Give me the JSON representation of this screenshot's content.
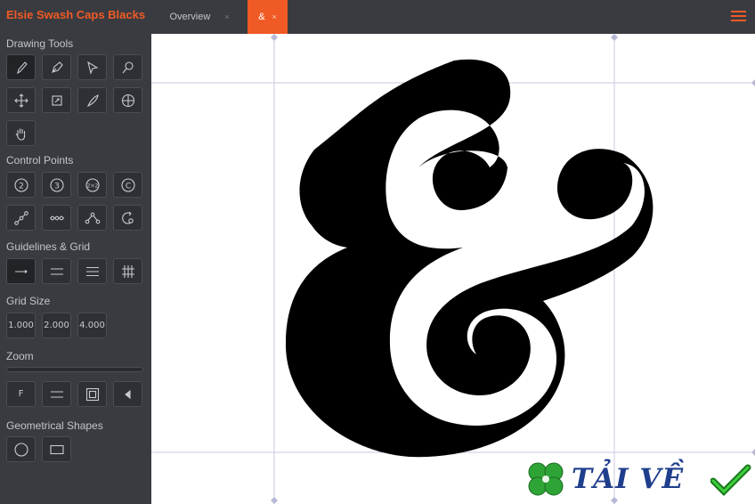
{
  "app_title": "Elsie Swash Caps Blacks",
  "sections": {
    "drawing_tools": "Drawing Tools",
    "control_points": "Control Points",
    "guidelines_grid": "Guidelines & Grid",
    "grid_size": "Grid Size",
    "zoom": "Zoom",
    "geometrical_shapes": "Geometrical Shapes"
  },
  "control_points_buttons": [
    "2",
    "3",
    "2×2",
    "C"
  ],
  "grid_size_buttons": [
    "1.000",
    "2.000",
    "4.000"
  ],
  "zoom_buttons": {
    "fit": "F"
  },
  "zoom_level": 0,
  "tabs": [
    {
      "label": "Overview",
      "close": "×"
    },
    {
      "label": "&",
      "close": "×"
    }
  ],
  "glyph": "&",
  "watermark": {
    "text": "TẢI VỀ"
  },
  "colors": {
    "accent": "#f05a24",
    "sidebar_bg": "#3a3b40",
    "guide": "#c8c8e0",
    "watermark": "#1f3e8c",
    "clover": "#2ea336"
  }
}
